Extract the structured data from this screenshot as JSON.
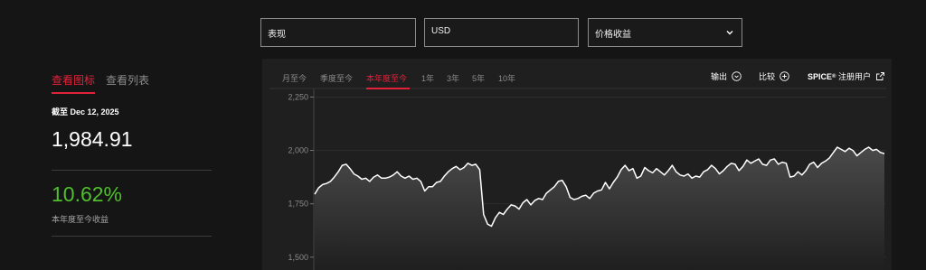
{
  "filters": {
    "type": "表现",
    "currency": "USD",
    "return_type": "价格收益"
  },
  "view_tabs": {
    "chart": "查看图标",
    "list": "查看列表"
  },
  "summary": {
    "as_of": "截至 Dec 12, 2025",
    "value": "1,984.91",
    "return_pct": "10.62%",
    "return_label": "本年度至今收益"
  },
  "periods": [
    "月至今",
    "季度至今",
    "本年度至今",
    "1年",
    "3年",
    "5年",
    "10年"
  ],
  "active_period": "本年度至今",
  "actions": {
    "export": "输出",
    "compare": "比较",
    "spice": "SPICE",
    "spice_reg": "®",
    "register": "注册用户"
  },
  "colors": {
    "accent": "#e2223b",
    "positive": "#4fbf2d",
    "line": "#ffffff"
  },
  "icons": {
    "dropdown": "chevron-down-icon",
    "export": "circle-chevron-down-icon",
    "compare": "circle-plus-icon",
    "external": "external-link-icon"
  },
  "chart_data": {
    "type": "area",
    "y_ticks": [
      "2,250",
      "2,000",
      "1,750",
      "1,500"
    ],
    "ylim": [
      1440,
      2290
    ],
    "grid": true,
    "values": [
      1795,
      1825,
      1840,
      1845,
      1855,
      1875,
      1900,
      1930,
      1935,
      1915,
      1890,
      1880,
      1865,
      1870,
      1855,
      1875,
      1885,
      1870,
      1870,
      1875,
      1885,
      1900,
      1880,
      1870,
      1880,
      1865,
      1870,
      1855,
      1810,
      1830,
      1830,
      1850,
      1855,
      1880,
      1900,
      1915,
      1925,
      1910,
      1920,
      1940,
      1930,
      1935,
      1910,
      1700,
      1655,
      1645,
      1685,
      1710,
      1700,
      1725,
      1745,
      1740,
      1725,
      1755,
      1770,
      1745,
      1765,
      1775,
      1770,
      1800,
      1815,
      1830,
      1855,
      1860,
      1830,
      1780,
      1770,
      1775,
      1785,
      1790,
      1775,
      1800,
      1810,
      1815,
      1850,
      1820,
      1850,
      1875,
      1910,
      1930,
      1905,
      1915,
      1870,
      1880,
      1920,
      1905,
      1895,
      1915,
      1900,
      1885,
      1905,
      1930,
      1900,
      1885,
      1880,
      1890,
      1870,
      1880,
      1875,
      1900,
      1910,
      1930,
      1915,
      1890,
      1905,
      1925,
      1940,
      1935,
      1905,
      1925,
      1955,
      1940,
      1950,
      1960,
      1935,
      1930,
      1955,
      1960,
      1935,
      1945,
      1940,
      1875,
      1880,
      1900,
      1885,
      1905,
      1935,
      1945,
      1920,
      1940,
      1950,
      1965,
      1990,
      2015,
      2005,
      1995,
      2010,
      2000,
      1975,
      1990,
      2005,
      2015,
      2000,
      2005,
      1990,
      1985
    ]
  }
}
